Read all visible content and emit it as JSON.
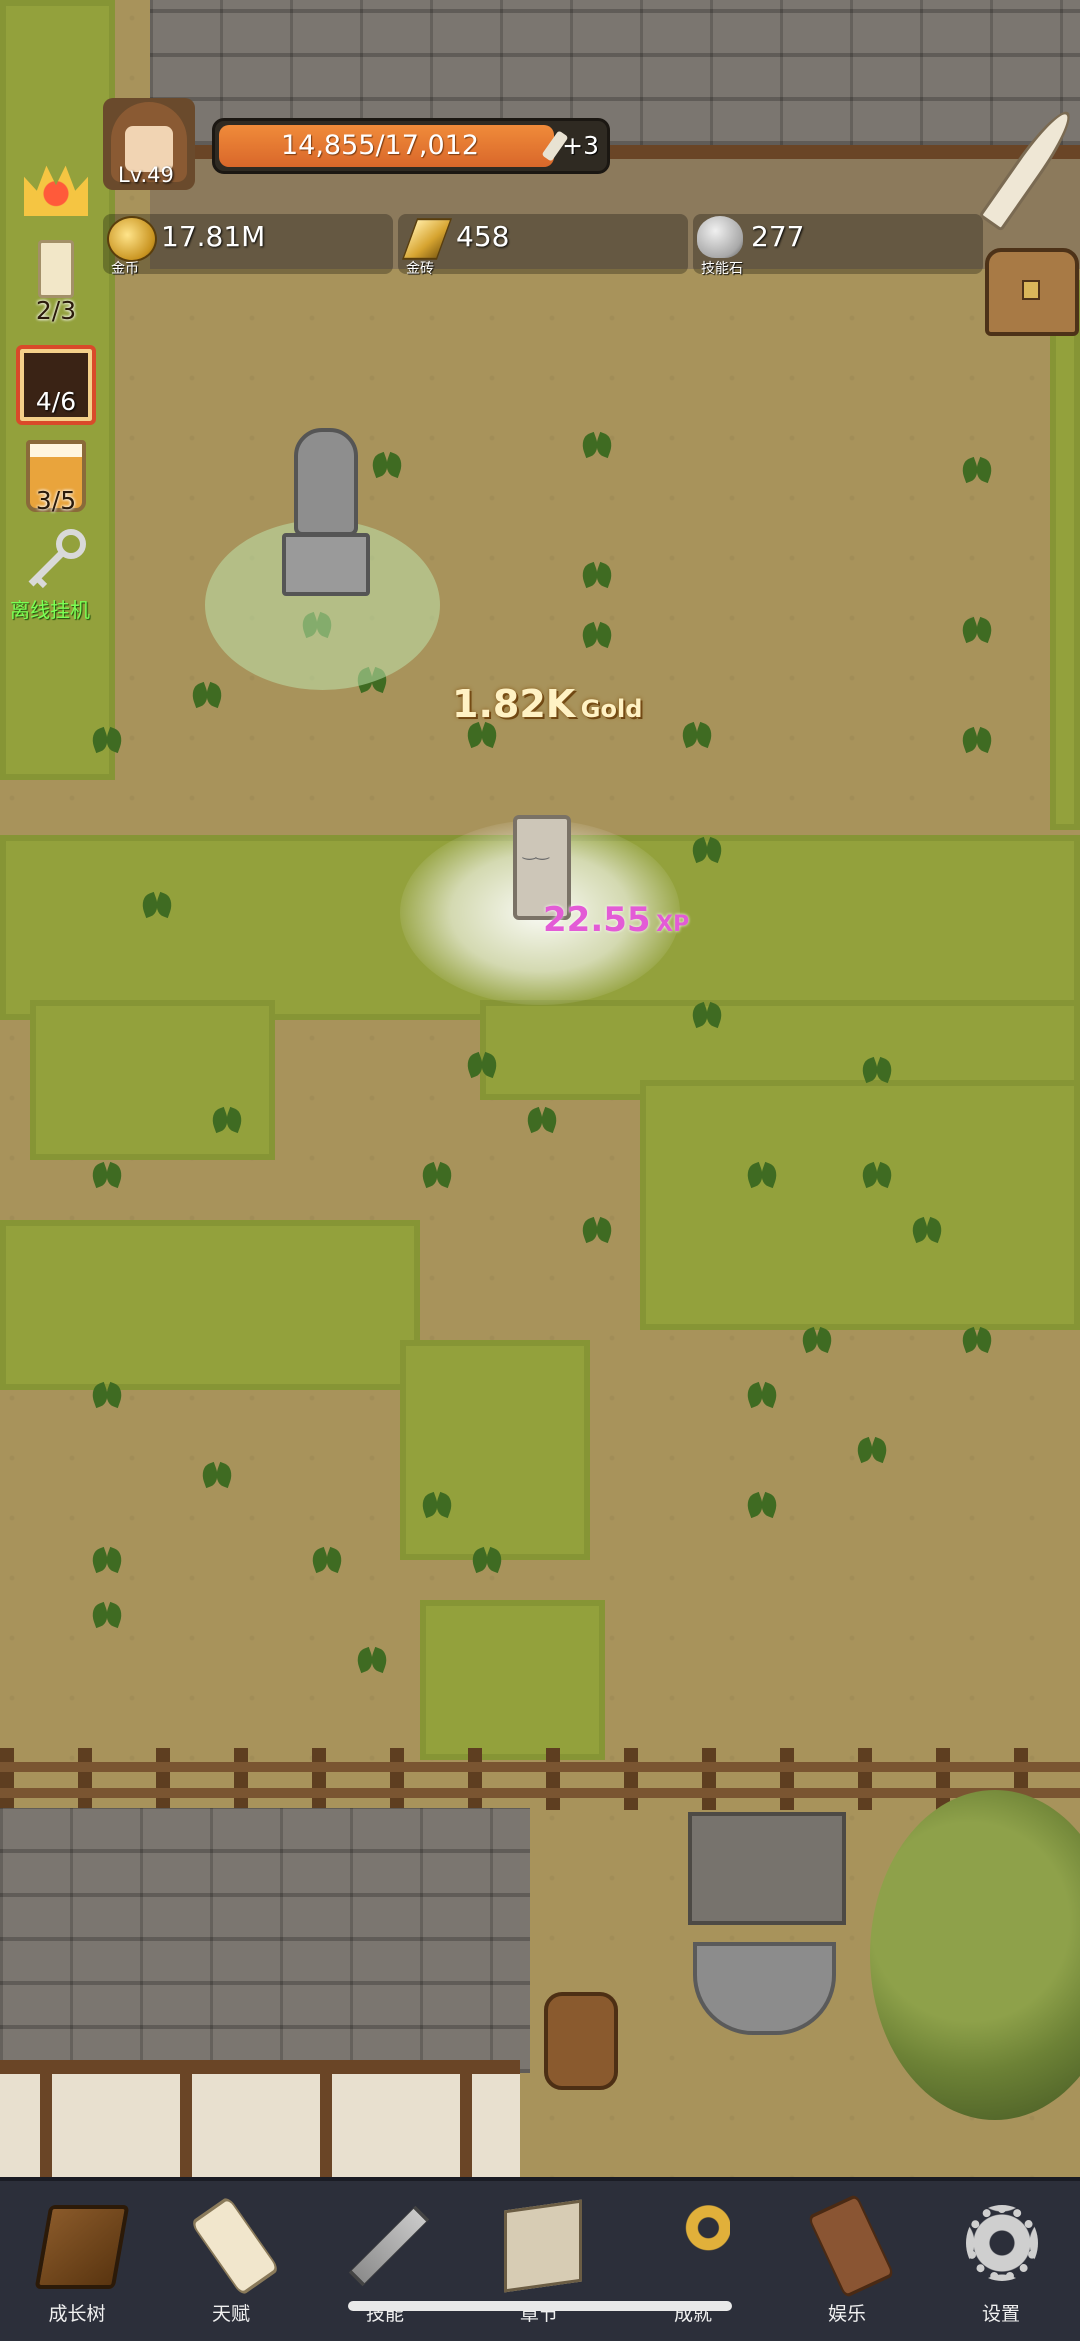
{
  "player": {
    "level": "Lv.49",
    "xp_text": "14,855/17,012",
    "xp_fraction": 0.873,
    "xp_bonus": "+3"
  },
  "resources": [
    {
      "icon": "gold-coin-icon",
      "value": "17.81M",
      "caption": "金币"
    },
    {
      "icon": "gold-bar-icon",
      "value": "458",
      "caption": "金砖"
    },
    {
      "icon": "skill-stone-icon",
      "value": "277",
      "caption": "技能石"
    }
  ],
  "side_items": {
    "crown": {
      "icon": "crown-icon"
    },
    "candle": {
      "icon": "candle-icon",
      "count": "2/3"
    },
    "dice": {
      "icon": "dice-icon",
      "count": "4/6"
    },
    "mug": {
      "icon": "beer-mug-icon",
      "count": "3/5"
    },
    "idle": {
      "icon": "key-icon",
      "label": "离线挂机"
    }
  },
  "right_items": {
    "quill": {
      "icon": "quill-icon"
    },
    "chest": {
      "icon": "treasure-chest-icon"
    }
  },
  "floating": {
    "gold_amount": "1.82K",
    "gold_unit": "Gold",
    "xp_amount": "22.55",
    "xp_unit": "XP"
  },
  "nav": [
    {
      "icon": "book-icon",
      "label": "成长树"
    },
    {
      "icon": "scroll-icon",
      "label": "天赋"
    },
    {
      "icon": "sword-icon",
      "label": "技能"
    },
    {
      "icon": "map-icon",
      "label": "章节"
    },
    {
      "icon": "golden-key-icon",
      "label": "成就"
    },
    {
      "icon": "brown-scroll-icon",
      "label": "娱乐"
    },
    {
      "icon": "gear-icon",
      "label": "设置"
    }
  ],
  "colors": {
    "xp_bar": "#e57a31",
    "gold_text": "#fff2c4",
    "xp_text": "#e35bd6",
    "idle_label": "#7bff54",
    "nav_bg": "#2c2f3a"
  }
}
